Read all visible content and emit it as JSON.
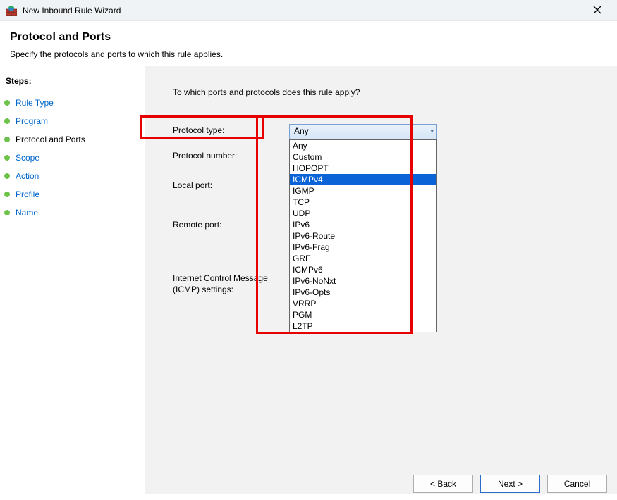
{
  "window": {
    "title": "New Inbound Rule Wizard"
  },
  "header": {
    "title": "Protocol and Ports",
    "subtitle": "Specify the protocols and ports to which this rule applies."
  },
  "steps": {
    "header": "Steps:",
    "items": [
      {
        "label": "Rule Type",
        "current": false
      },
      {
        "label": "Program",
        "current": false
      },
      {
        "label": "Protocol and Ports",
        "current": true
      },
      {
        "label": "Scope",
        "current": false
      },
      {
        "label": "Action",
        "current": false
      },
      {
        "label": "Profile",
        "current": false
      },
      {
        "label": "Name",
        "current": false
      }
    ]
  },
  "main": {
    "prompt": "To which ports and protocols does this rule apply?",
    "labels": {
      "protocol_type": "Protocol type:",
      "protocol_number": "Protocol number:",
      "local_port": "Local port:",
      "remote_port": "Remote port:",
      "icmp_settings_line1": "Internet Control Message",
      "icmp_settings_line2": "(ICMP) settings:"
    },
    "protocol_combo": {
      "selected": "Any",
      "options": [
        "Any",
        "Custom",
        "HOPOPT",
        "ICMPv4",
        "IGMP",
        "TCP",
        "UDP",
        "IPv6",
        "IPv6-Route",
        "IPv6-Frag",
        "GRE",
        "ICMPv6",
        "IPv6-NoNxt",
        "IPv6-Opts",
        "VRRP",
        "PGM",
        "L2TP"
      ],
      "highlighted": "ICMPv4"
    }
  },
  "buttons": {
    "back": "< Back",
    "next": "Next >",
    "cancel": "Cancel"
  }
}
